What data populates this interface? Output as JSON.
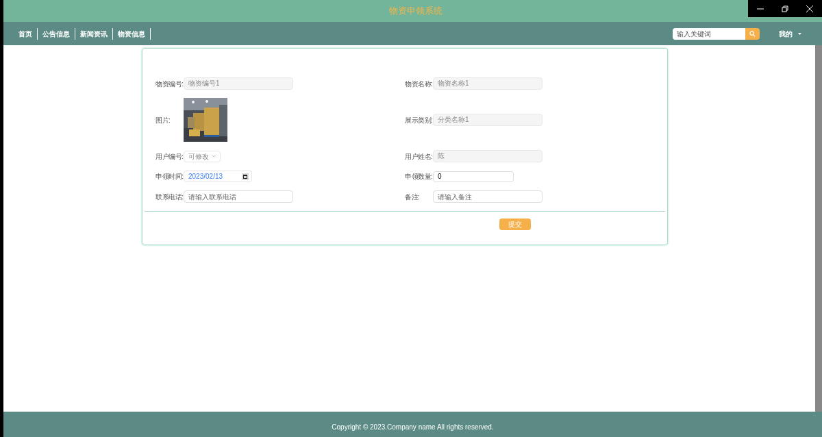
{
  "title": "物资申领系统",
  "nav": [
    {
      "label": "首页"
    },
    {
      "label": "公告信息"
    },
    {
      "label": "新闻资讯"
    },
    {
      "label": "物资信息"
    }
  ],
  "search": {
    "placeholder": "输入关键词"
  },
  "user_menu": {
    "label": "我的"
  },
  "form": {
    "rows": [
      [
        {
          "label": "物资编号:",
          "kind": "readonly",
          "value": "物资编号1"
        },
        {
          "label": "物资名称:",
          "kind": "readonly",
          "value": "物资名称1"
        }
      ],
      [
        {
          "label": "图片:",
          "kind": "picture"
        },
        {
          "label": "展示类别:",
          "kind": "readonly",
          "value": "分类名称1"
        }
      ],
      [
        {
          "label": "用户编号:",
          "kind": "select",
          "value": "可修改"
        },
        {
          "label": "用户姓名:",
          "kind": "readonly",
          "value": "陈"
        }
      ],
      [
        {
          "label": "申领时间:",
          "kind": "date",
          "value": "2023/02/13"
        },
        {
          "label": "申领数量:",
          "kind": "number",
          "value": "0"
        }
      ],
      [
        {
          "label": "联系电话:",
          "kind": "input",
          "placeholder": "请输入联系电话"
        },
        {
          "label": "备注:",
          "kind": "input",
          "placeholder": "请输入备注"
        }
      ]
    ],
    "submit": "提交"
  },
  "footer": "Copyright © 2023.Company name All rights reserved."
}
